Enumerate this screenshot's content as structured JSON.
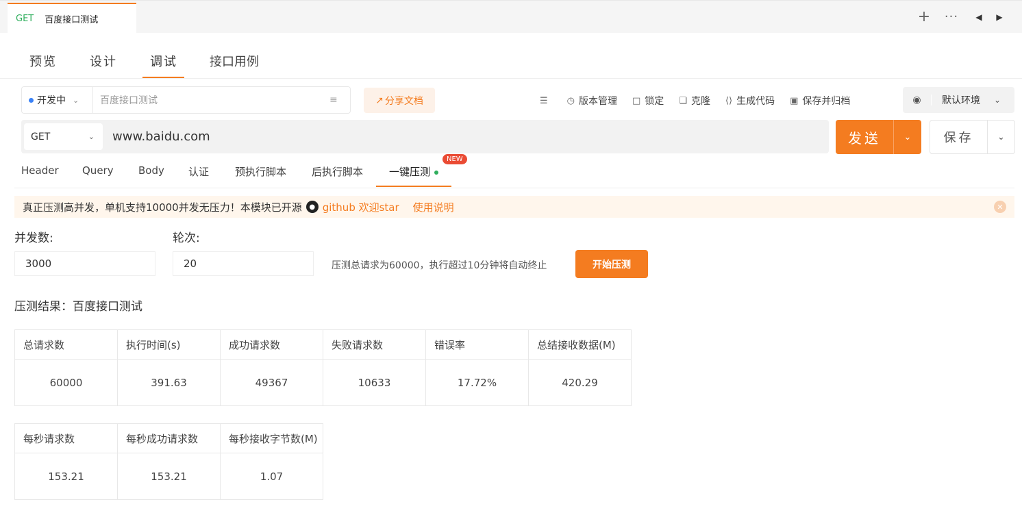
{
  "doc_tab": {
    "method": "GET",
    "name": "百度接口测试"
  },
  "strip_icons": {
    "add": "+",
    "more": "···",
    "prev": "◀",
    "next": "▶"
  },
  "main_tabs": [
    "预览",
    "设计",
    "调试",
    "接口用例"
  ],
  "toolbar": {
    "status": "开发中",
    "name_value": "百度接口测试",
    "share": "分享文档",
    "tools": [
      "版本管理",
      "锁定",
      "克隆",
      "生成代码",
      "保存并归档"
    ],
    "env": "默认环境"
  },
  "request": {
    "method": "GET",
    "url": "www.baidu.com",
    "send": "发送",
    "save": "保存"
  },
  "sub_tabs": [
    "Header",
    "Query",
    "Body",
    "认证",
    "预执行脚本",
    "后执行脚本",
    "一键压测"
  ],
  "badge_new": "NEW",
  "notice": {
    "text": "真正压测高并发，单机支持10000并发无压力！本模块已开源",
    "link": "github 欢迎star",
    "usage": "使用说明"
  },
  "config": {
    "concurrency_label": "并发数:",
    "rounds_label": "轮次:",
    "concurrency": "3000",
    "rounds": "20",
    "hint": "压测总请求为60000，执行超过10分钟将自动终止",
    "start": "开始压测"
  },
  "result_title": "压测结果：百度接口测试",
  "table1": {
    "headers": [
      "总请求数",
      "执行时间(s)",
      "成功请求数",
      "失败请求数",
      "错误率",
      "总结接收数据(M)"
    ],
    "values": [
      "60000",
      "391.63",
      "49367",
      "10633",
      "17.72%",
      "420.29"
    ]
  },
  "table2": {
    "headers": [
      "每秒请求数",
      "每秒成功请求数",
      "每秒接收字节数(M)"
    ],
    "values": [
      "153.21",
      "153.21",
      "1.07"
    ]
  }
}
